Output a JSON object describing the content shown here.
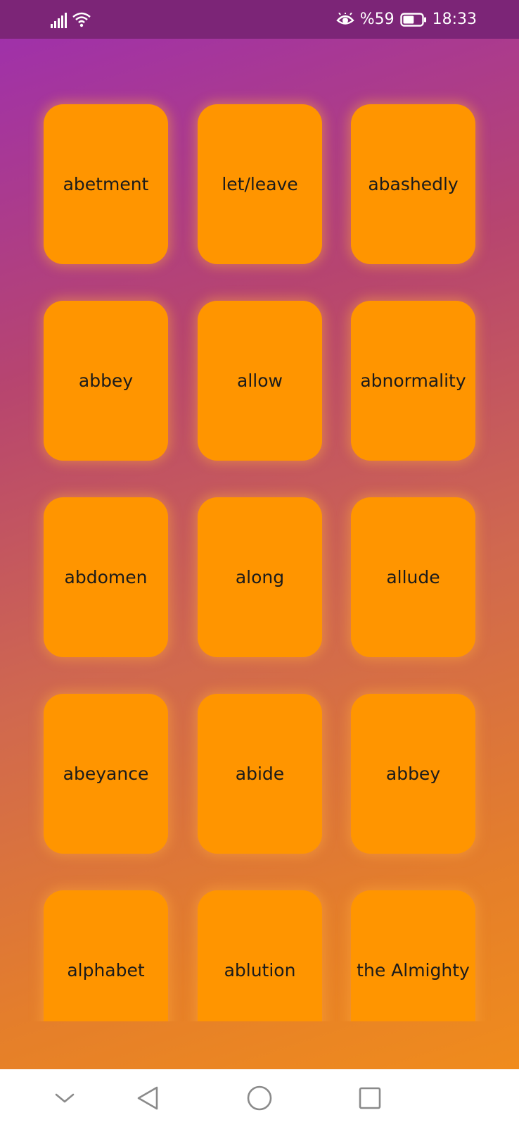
{
  "status_bar": {
    "battery_percent": "%59",
    "time": "18:33",
    "icons": [
      "signal-icon",
      "wifi-icon",
      "eye-comfort-icon",
      "battery-icon"
    ],
    "battery_level": 0.59,
    "background_color": "#7c2577"
  },
  "cards": [
    {
      "label": "abetment"
    },
    {
      "label": "let/leave"
    },
    {
      "label": "abashedly"
    },
    {
      "label": "abbey"
    },
    {
      "label": "allow"
    },
    {
      "label": "abnormality"
    },
    {
      "label": "abdomen"
    },
    {
      "label": "along"
    },
    {
      "label": "allude"
    },
    {
      "label": "abeyance"
    },
    {
      "label": "abide"
    },
    {
      "label": "abbey"
    },
    {
      "label": "alphabet"
    },
    {
      "label": "ablution"
    },
    {
      "label": "the Almighty"
    }
  ],
  "nav_bar": {
    "icons": [
      "chevron-down-icon",
      "back-icon",
      "home-icon",
      "recents-icon"
    ]
  },
  "colors": {
    "card": "#ff9500",
    "gradient_top": "#9d2fb0",
    "gradient_bottom": "#f38f18"
  }
}
